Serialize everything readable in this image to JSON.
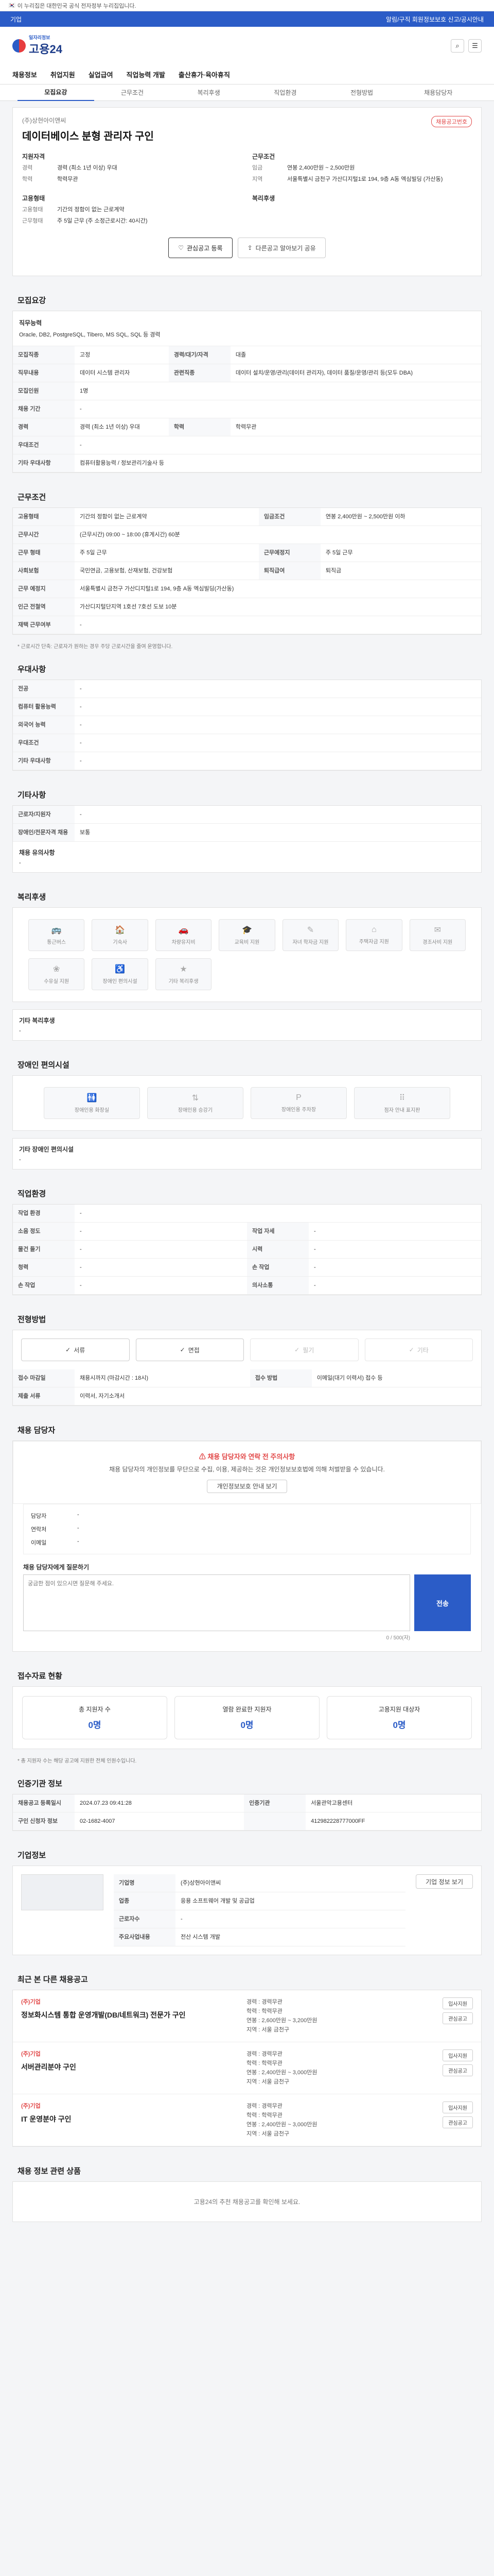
{
  "gov_banner": "이 누리집은 대한민국 공식 전자정부 누리집입니다.",
  "topbar": {
    "left": "기업",
    "right": "알림/구직 회원정보보호 신고/공시안내"
  },
  "logo": {
    "small": "일자리정보",
    "main": "고용24"
  },
  "gnb": [
    "채용정보",
    "취업지원",
    "실업급여",
    "직업능력 개발",
    "출산휴가·육아휴직"
  ],
  "tabs": [
    "모집요강",
    "근무조건",
    "복리후생",
    "직업환경",
    "전형방법",
    "채용담당자"
  ],
  "job": {
    "company": "(주)상현아이앤씨",
    "title": "데이터베이스 분형 관리자 구인",
    "tag": "채용공고번호",
    "qual_label": "지원자격",
    "qual": [
      {
        "k": "경력",
        "v": "경력 (최소 1년 이상) 우대"
      },
      {
        "k": "학력",
        "v": "학력무관"
      }
    ],
    "cond_label": "근무조건",
    "cond": [
      {
        "k": "임금",
        "v": "연봉 2,400만원 ~ 2,500만원"
      },
      {
        "k": "지역",
        "v": "서울특별시 금천구 가산디지털1로 194, 9층 A동 엑심빌딩 (가산동)"
      }
    ],
    "emp_label": "고용형태",
    "emp": [
      {
        "k": "고용형태",
        "v": "기간의 정함이 없는 근로계약"
      },
      {
        "k": "근무형태",
        "v": "주 5일 근무 (주 소정근로시간: 40시간)"
      }
    ],
    "welfare_label": "복리후생"
  },
  "buttons": {
    "scrap": "관심공고 등록",
    "share": "다른공고 알아보기 공유"
  },
  "recruit": {
    "title": "모집요강",
    "skill_label": "직무능력",
    "skill": "Oracle, DB2, PostgreSQL, Tibero, MS SQL, SQL 등 경력",
    "rows": [
      [
        "모집직종",
        "고정",
        "경력/대기/자격",
        "대졸"
      ],
      [
        "직무내용",
        "데이터 시스템 관리자",
        "관련직종",
        "데이터 설치/운영/관리(데이터 관리자), 데이터 품질/운영/관리 등(모두 DBA)"
      ],
      [
        "모집인원",
        "1명",
        "",
        ""
      ],
      [
        "채용 기간",
        "-",
        "",
        ""
      ],
      [
        "경력",
        "경력 (최소 1년 이상) 우대",
        "학력",
        "학력무관"
      ],
      [
        "우대조건",
        "-",
        "",
        ""
      ],
      [
        "기타 우대사항",
        "컴퓨터활용능력 / 정보관리기술사 등",
        "",
        ""
      ]
    ]
  },
  "work": {
    "title": "근무조건",
    "rows": [
      [
        "고용형태",
        "기간의 정함이 없는 근로계약",
        "임금조건",
        "연봉 2,400만원 ~ 2,500만원 이하"
      ],
      [
        "근무시간",
        "(근무시간) 09:00 ~ 18:00 (휴게시간) 60분",
        "",
        ""
      ],
      [
        "근무 형태",
        "주 5일 근무",
        "근무예정지",
        "주 5일 근무"
      ],
      [
        "사회보험",
        "국민연금, 고용보험, 산재보험, 건강보험",
        "퇴직급여",
        "퇴직금"
      ],
      [
        "근무 예정지",
        "서울특별시 금천구 가산디지털1로 194, 9층 A동 엑심빌딩(가산동)",
        "",
        ""
      ],
      [
        "인근 전철역",
        "가산디지털단지역 1호선 7호선 도보 10분",
        "",
        ""
      ],
      [
        "재택 근무여부",
        "-",
        "",
        ""
      ]
    ],
    "note": "* 근로시간 단축: 근로자가 원하는 경우 주당 근로시간을 줄여 운영합니다."
  },
  "other": {
    "title": "우대사항",
    "rows": [
      [
        "전공",
        "-"
      ],
      [
        "컴퓨터 활용능력",
        "-"
      ],
      [
        "외국어 능력",
        "-"
      ],
      [
        "우대조건",
        "-"
      ],
      [
        "기타 우대사항",
        "-"
      ]
    ]
  },
  "extra": {
    "title": "기타사항",
    "rows": [
      [
        "근로자/지원자",
        "-"
      ],
      [
        "장애인/전문자격 채용",
        "보통"
      ]
    ],
    "etc_label": "채용 유의사항",
    "etc": "-"
  },
  "benefit": {
    "title": "복리후생",
    "items": [
      "통근버스",
      "기숙사",
      "차량유지비",
      "교육비 지원",
      "자녀 학자금 지원",
      "주택자금 지원",
      "경조사비 지원",
      "수유실 지원",
      "장애인 편의시설",
      "기타 복리후생"
    ],
    "etc_label": "기타 복리후생",
    "etc": "-"
  },
  "disab": {
    "title": "장애인 편의시설",
    "items": [
      "장애인용 화장실",
      "장애인용 승강기",
      "장애인용 주차장",
      "점자 안내 표지판"
    ],
    "etc_label": "기타 장애인 편의시설",
    "etc": "-"
  },
  "env": {
    "title": "직업환경",
    "rows": [
      [
        "작업 환경",
        "-",
        "",
        ""
      ],
      [
        "소음 정도",
        "-",
        "작업 자세",
        "-"
      ],
      [
        "물건 들기",
        "-",
        "시력",
        "-"
      ],
      [
        "청력",
        "-",
        "손 작업",
        "-"
      ],
      [
        "손 작업",
        "-",
        "의사소통",
        "-"
      ]
    ]
  },
  "howto": {
    "title": "전형방법",
    "methods": [
      "서류",
      "면접",
      "필기",
      "기타"
    ],
    "rows": [
      [
        "접수 마감일",
        "채용시까지 (마감시간 : 18시)",
        "접수 방법",
        "이메일(대기 이력서) 접수 등"
      ],
      [
        "제출 서류",
        "이력서, 자기소개서",
        "",
        ""
      ]
    ]
  },
  "contact": {
    "title": "채용 담당자",
    "alert_title": "채용 담당자와 연락 전 주의사항",
    "alert": "채용 담당자의 개인정보를 무단으로 수집, 이용, 제공하는 것은 개인정보보호법에 의해 처벌받을 수 있습니다.",
    "alert_btn": "개인정보보호 안내 보기",
    "dept_label": "담당자",
    "dept": "-",
    "phone_label": "연락처",
    "email_label": "이메일",
    "q_label": "채용 담당자에게 질문하기",
    "q_placeholder": "궁금한 점이 있으시면 질문해 주세요.",
    "q_btn": "전송",
    "q_count": "0 / 500(자)"
  },
  "status": {
    "title": "접수자료 현황",
    "items": [
      {
        "k": "총 지원자 수",
        "v": "0명"
      },
      {
        "k": "열람 완료한 지원자",
        "v": "0명"
      },
      {
        "k": "고용지원 대상자",
        "v": "0명"
      }
    ],
    "note": "* 총 지원자 수는 해당 공고에 지원한 전체 인원수입니다."
  },
  "regist": {
    "title": "인증기관 정보",
    "rows": [
      [
        "채용공고 등록일시",
        "2024.07.23 09:41:28",
        "인증기관",
        "서울관악고용센터"
      ],
      [
        "구인 신청자 정보",
        "02-1682-4007",
        "",
        "412982228777000FF"
      ]
    ]
  },
  "corp": {
    "title": "기업정보",
    "rows": [
      [
        "기업명",
        "(주)상현아이앤씨"
      ],
      [
        "업종",
        "응용 소프트웨어 개발 및 공급업"
      ],
      [
        "근로자수",
        "-"
      ],
      [
        "주요사업내용",
        "전산 시스템 개발"
      ]
    ],
    "btn": "기업 정보 보기"
  },
  "recs": {
    "title": "최근 본 다른 채용공고",
    "items": [
      {
        "company": "(주)기업",
        "title": "정보화시스템 통합 운영개발(DB/네트워크) 전문가 구인",
        "m": [
          "경력 : 경력무관",
          "학력 : 학력무관",
          "연봉 : 2,600만원 ~ 3,200만원",
          "지역 : 서울 금천구"
        ]
      },
      {
        "company": "(주)기업",
        "title": "서버관리분야 구인",
        "m": [
          "경력 : 경력무관",
          "학력 : 학력무관",
          "연봉 : 2,400만원 ~ 3,000만원",
          "지역 : 서울 금천구"
        ]
      },
      {
        "company": "(주)기업",
        "title": "IT 운영분야 구인",
        "m": [
          "경력 : 경력무관",
          "학력 : 학력무관",
          "연봉 : 2,400만원 ~ 3,000만원",
          "지역 : 서울 금천구"
        ]
      }
    ],
    "btns": [
      "입사지원",
      "관심공고"
    ]
  },
  "coupang": {
    "title": "채용 정보 관련 상품",
    "text": "고용24의 추천 채용공고를 확인해 보세요."
  }
}
